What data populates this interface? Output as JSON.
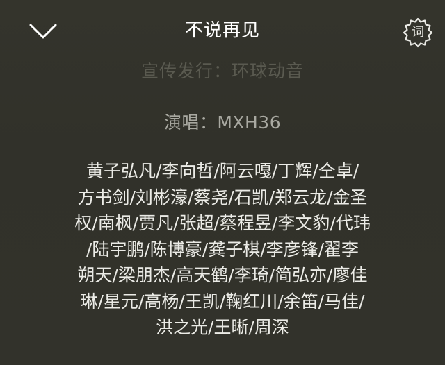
{
  "header": {
    "collapse_icon": "chevron-down-icon",
    "title": "不说再见",
    "lyrics_button_label": "词",
    "lyrics_icon": "lyrics-gear-icon"
  },
  "credits_scroll": {
    "faded_line": "宣传发行：环球动音",
    "singer_line": "演唱：MXH36",
    "members_lines": [
      "黄子弘凡/李向哲/阿云嘎/丁辉/仝卓/",
      "方书剑/刘彬濠/蔡尧/石凯/郑云龙/金圣",
      "权/南枫/贾凡/张超/蔡程昱/李文豹/代玮",
      "/陆宇鹏/陈博豪/龚子棋/李彦锋/翟李",
      "朔天/梁朋杰/高天鹤/李琦/简弘亦/廖佳",
      "琳/星元/高杨/王凯/鞠红川/余笛/马佳/",
      "洪之光/王晰/周深"
    ]
  },
  "colors": {
    "background": "#33332b",
    "title": "#ffffff",
    "faded_text": "#5a5a50",
    "secondary_text": "#a9a9a1",
    "primary_text": "#ebebe6"
  }
}
